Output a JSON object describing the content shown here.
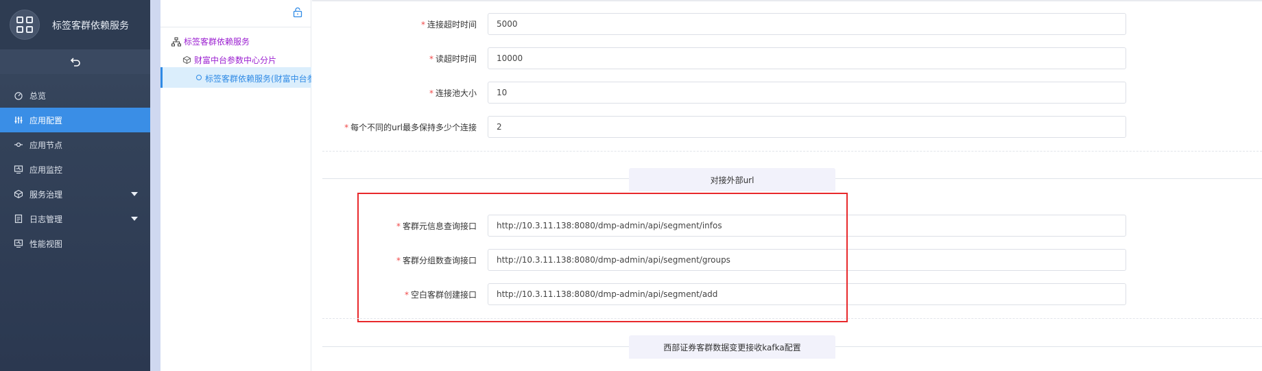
{
  "app": {
    "title": "标签客群依赖服务"
  },
  "sidebar": {
    "items": [
      {
        "label": "总览",
        "icon": "dashboard-icon",
        "active": false,
        "has_submenu": false
      },
      {
        "label": "应用配置",
        "icon": "sliders-icon",
        "active": true,
        "has_submenu": false
      },
      {
        "label": "应用节点",
        "icon": "node-icon",
        "active": false,
        "has_submenu": false
      },
      {
        "label": "应用监控",
        "icon": "monitor-icon",
        "active": false,
        "has_submenu": false
      },
      {
        "label": "服务治理",
        "icon": "cube-icon",
        "active": false,
        "has_submenu": true
      },
      {
        "label": "日志管理",
        "icon": "document-icon",
        "active": false,
        "has_submenu": true
      },
      {
        "label": "性能视图",
        "icon": "monitor-icon",
        "active": false,
        "has_submenu": false
      }
    ]
  },
  "tree": {
    "root": "标签客群依赖服务",
    "child": "财富中台参数中心分片",
    "selected": "标签客群依赖服务(财富中台参"
  },
  "form": {
    "fields": [
      {
        "label": "连接超时时间",
        "value": "5000",
        "required": true
      },
      {
        "label": "读超时时间",
        "value": "10000",
        "required": true
      },
      {
        "label": "连接池大小",
        "value": "10",
        "required": true
      },
      {
        "label": "每个不同的url最多保持多少个连接",
        "value": "2",
        "required": true
      }
    ],
    "section1": "对接外部url",
    "url_fields": [
      {
        "label": "客群元信息查询接口",
        "value": "http://10.3.11.138:8080/dmp-admin/api/segment/infos",
        "required": true
      },
      {
        "label": "客群分组数查询接口",
        "value": "http://10.3.11.138:8080/dmp-admin/api/segment/groups",
        "required": true
      },
      {
        "label": "空白客群创建接口",
        "value": "http://10.3.11.138:8080/dmp-admin/api/segment/add",
        "required": true
      }
    ],
    "section2": "西部证券客群数据变更接收kafka配置",
    "required_mark": "*"
  },
  "colors": {
    "sidebar_bg": "#34435a",
    "active": "#3a8ee6",
    "tree_link": "#9b1fd0",
    "required": "#f04a4a",
    "highlight_border": "#e8282b"
  }
}
